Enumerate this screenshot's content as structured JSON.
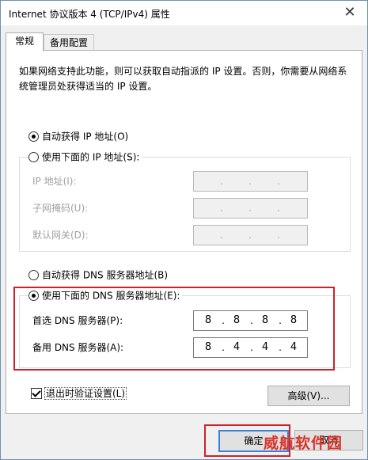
{
  "window": {
    "title": "Internet 协议版本 4 (TCP/IPv4) 属性",
    "close_glyph": "✕"
  },
  "tabs": [
    {
      "label": "常规",
      "active": true
    },
    {
      "label": "备用配置",
      "active": false
    }
  ],
  "description": "如果网络支持此功能，则可以获取自动指派的 IP 设置。否则，你需要从网络系统管理员处获得适当的 IP 设置。",
  "ip": {
    "auto_label": "自动获得 IP 地址(O)",
    "auto_selected": true,
    "manual_label": "使用下面的 IP 地址(S):",
    "manual_selected": false,
    "fields": [
      {
        "label": "IP 地址(I):",
        "octets": [
          "",
          "",
          "",
          ""
        ]
      },
      {
        "label": "子网掩码(U):",
        "octets": [
          "",
          "",
          "",
          ""
        ]
      },
      {
        "label": "默认网关(D):",
        "octets": [
          "",
          "",
          "",
          ""
        ]
      }
    ]
  },
  "dns": {
    "auto_label": "自动获得 DNS 服务器地址(B)",
    "auto_selected": false,
    "manual_label": "使用下面的 DNS 服务器地址(E):",
    "manual_selected": true,
    "preferred": {
      "label": "首选 DNS 服务器(P):",
      "octets": [
        "8",
        "8",
        "8",
        "8"
      ]
    },
    "alternate": {
      "label": "备用 DNS 服务器(A):",
      "octets": [
        "8",
        "4",
        "4",
        "4"
      ]
    }
  },
  "validate": {
    "label": "退出时验证设置(L)",
    "checked": true
  },
  "buttons": {
    "advanced": "高级(V)...",
    "ok": "确定",
    "cancel": "取消"
  },
  "watermark": "威航软件园",
  "colors": {
    "highlight_box": "#d0202a",
    "default_button_border": "#3c7fd6"
  },
  "icons": {
    "close": "close-icon"
  }
}
